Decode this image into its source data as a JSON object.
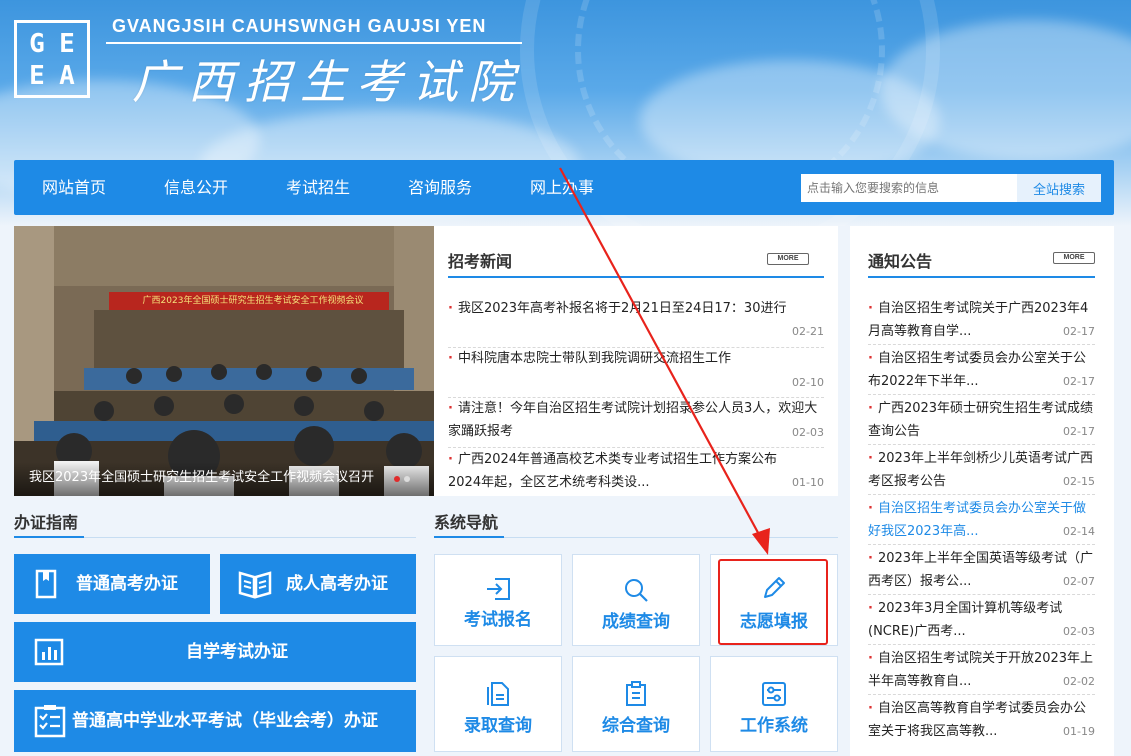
{
  "header": {
    "logo_letters": [
      "G",
      "E",
      "E",
      "A"
    ],
    "site_name_latin": "GVANGJSIH CAUHSWNGH GAUJSI YEN",
    "site_name_cn": "广西招生考试院"
  },
  "nav": {
    "items": [
      "网站首页",
      "信息公开",
      "考试招生",
      "咨询服务",
      "网上办事"
    ],
    "search_placeholder": "点击输入您要搜索的信息",
    "search_button": "全站搜索"
  },
  "slider": {
    "banner_text": "广西2023年全国硕士研究生招生考试安全工作视频会议",
    "caption": "我区2023年全国硕士研究生招生考试安全工作视频会议召开",
    "dots": 2,
    "active_dot": 0
  },
  "news": {
    "title": "招考新闻",
    "more": "MORE",
    "items": [
      {
        "text": "我区2023年高考补报名将于2月21日至24日17：30进行",
        "date": "02-21"
      },
      {
        "text": "中科院唐本忠院士带队到我院调研交流招生工作",
        "date": "02-10"
      },
      {
        "text": "请注意！今年自治区招生考试院计划招录参公人员3人，欢迎大家踊跃报考",
        "date": "02-03"
      },
      {
        "text": "广西2024年普通高校艺术类专业考试招生工作方案公布 2024年起，全区艺术统考科类设...",
        "date": "01-10"
      }
    ]
  },
  "notices": {
    "title": "通知公告",
    "more": "MORE",
    "items": [
      {
        "text": "自治区招生考试院关于广西2023年4月高等教育自学...",
        "date": "02-17",
        "highlight": false
      },
      {
        "text": "自治区招生考试委员会办公室关于公布2022年下半年...",
        "date": "02-17",
        "highlight": false
      },
      {
        "text": "广西2023年硕士研究生招生考试成绩查询公告",
        "date": "02-17",
        "highlight": false
      },
      {
        "text": "2023年上半年剑桥少儿英语考试广西考区报考公告",
        "date": "02-15",
        "highlight": false
      },
      {
        "text": "自治区招生考试委员会办公室关于做好我区2023年高...",
        "date": "02-14",
        "highlight": true
      },
      {
        "text": "2023年上半年全国英语等级考试（广西考区）报考公...",
        "date": "02-07",
        "highlight": false
      },
      {
        "text": "2023年3月全国计算机等级考试(NCRE)广西考...",
        "date": "02-03",
        "highlight": false
      },
      {
        "text": "自治区招生考试院关于开放2023年上半年高等教育自...",
        "date": "02-02",
        "highlight": false
      },
      {
        "text": "自治区高等教育自学考试委员会办公室关于将我区高等教...",
        "date": "01-19",
        "highlight": false
      }
    ]
  },
  "guide": {
    "title": "办证指南",
    "buttons": [
      "普通高考办证",
      "成人高考办证",
      "自学考试办证",
      "普通高中学业水平考试（毕业会考）办证"
    ]
  },
  "sysnav": {
    "title": "系统导航",
    "cards": [
      "考试报名",
      "成绩查询",
      "志愿填报",
      "录取查询",
      "综合查询",
      "工作系统"
    ]
  },
  "colors": {
    "brand_blue": "#1e8ae6",
    "highlight_red": "#e8231c",
    "notice_highlight": "#1e8ae6"
  }
}
